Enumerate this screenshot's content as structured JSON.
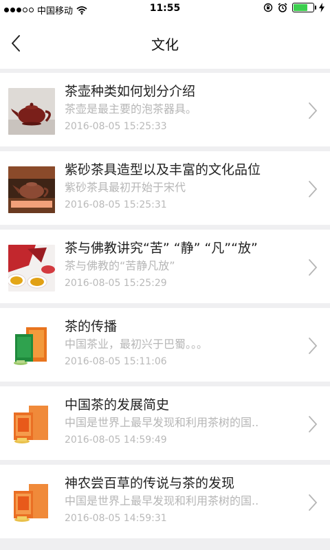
{
  "status_bar": {
    "carrier": "中国移动",
    "time": "11:55",
    "signal_icon": "signal-dots-icon",
    "wifi_icon": "wifi-icon",
    "battery_level": 0.7,
    "battery_color": "#3ccf4e"
  },
  "nav": {
    "title": "文化",
    "back_icon": "chevron-left-icon"
  },
  "articles": [
    {
      "title": "茶壶种类如何划分介绍",
      "desc": " 茶壶是最主要的泡茶器具。",
      "date": "2016-08-05 15:25:33",
      "thumb": "teapot"
    },
    {
      "title": "紫砂茶具造型以及丰富的文化品位",
      "desc": "紫砂茶具最初开始于宋代",
      "date": "2016-08-05 15:25:31",
      "thumb": "teapot-board"
    },
    {
      "title": "茶与佛教讲究“苦” “静” “凡”“放”",
      "desc": "茶与佛教的“苦静凡放”",
      "date": "2016-08-05 15:25:29",
      "thumb": "tea-cups"
    },
    {
      "title": "茶的传播",
      "desc": "中国茶业，最初兴于巴蜀。。。",
      "date": "2016-08-05 15:11:06",
      "thumb": "green-tea-box"
    },
    {
      "title": "中国茶的发展简史",
      "desc": "中国是世界上最早发现和利用茶树的国..",
      "date": "2016-08-05 14:59:49",
      "thumb": "orange-tea-box"
    },
    {
      "title": "神农尝百草的传说与茶的发现",
      "desc": "中国是世界上最早发现和利用茶树的国..",
      "date": "2016-08-05 14:59:31",
      "thumb": "orange-tea-box"
    }
  ]
}
